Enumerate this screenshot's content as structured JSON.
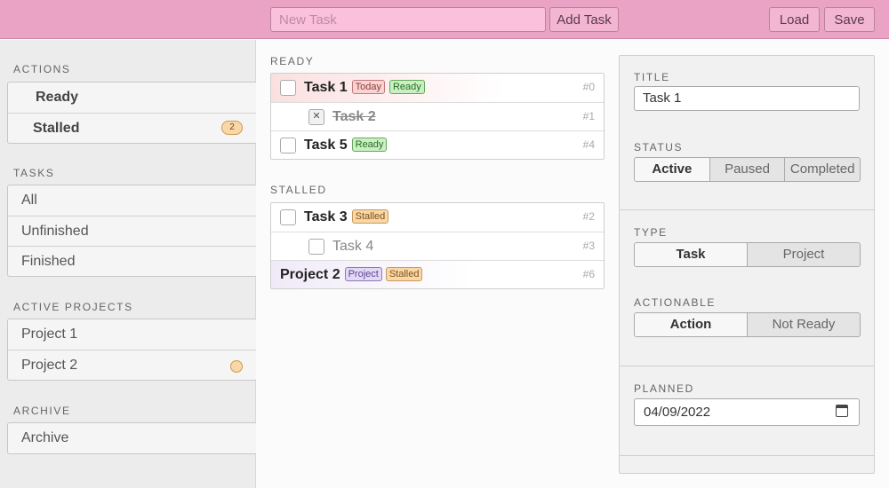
{
  "toolbar": {
    "new_task_placeholder": "New Task",
    "add_task_label": "Add Task",
    "load_label": "Load",
    "save_label": "Save"
  },
  "sidebar": {
    "actions_heading": "ACTIONS",
    "actions": [
      {
        "label": "Ready"
      },
      {
        "label": "Stalled",
        "count": "2"
      }
    ],
    "tasks_heading": "TASKS",
    "tasks": [
      {
        "label": "All"
      },
      {
        "label": "Unfinished"
      },
      {
        "label": "Finished"
      }
    ],
    "projects_heading": "ACTIVE PROJECTS",
    "projects": [
      {
        "label": "Project 1"
      },
      {
        "label": "Project 2"
      }
    ],
    "archive_heading": "ARCHIVE",
    "archive": [
      {
        "label": "Archive"
      }
    ]
  },
  "lists": {
    "ready_heading": "READY",
    "ready": [
      {
        "name": "Task 1",
        "tags": [
          "Today",
          "Ready"
        ],
        "id": "#0",
        "checked": false
      },
      {
        "name": "Task 2",
        "tags": [],
        "id": "#1",
        "checked": true
      },
      {
        "name": "Task 5",
        "tags": [
          "Ready"
        ],
        "id": "#4",
        "checked": false
      }
    ],
    "stalled_heading": "STALLED",
    "stalled": [
      {
        "name": "Task 3",
        "tags": [
          "Stalled"
        ],
        "id": "#2"
      },
      {
        "name": "Task 4",
        "tags": [],
        "id": "#3"
      },
      {
        "name": "Project 2",
        "tags": [
          "Project",
          "Stalled"
        ],
        "id": "#6"
      }
    ]
  },
  "detail": {
    "title_label": "TITLE",
    "title_value": "Task 1",
    "status_label": "STATUS",
    "status_options": [
      "Active",
      "Paused",
      "Completed"
    ],
    "status_selected": "Active",
    "type_label": "TYPE",
    "type_options": [
      "Task",
      "Project"
    ],
    "type_selected": "Task",
    "actionable_label": "ACTIONABLE",
    "actionable_options": [
      "Action",
      "Not Ready"
    ],
    "actionable_selected": "Action",
    "planned_label": "PLANNED",
    "planned_value": "04/09/2022"
  },
  "colors": {
    "topbar": "#eaa3c4",
    "today_tag": "#fbd3d3",
    "ready_tag": "#c9f0c3",
    "stalled_tag": "#fbd7a8",
    "project_tag": "#e3d9f6"
  },
  "icons": {
    "planned_calendar": "calendar-icon",
    "checked_box": "x-mark-icon"
  }
}
